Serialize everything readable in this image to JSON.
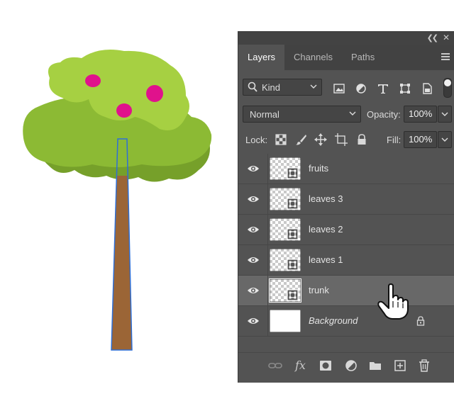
{
  "tabs": [
    {
      "label": "Layers",
      "active": true
    },
    {
      "label": "Channels",
      "active": false
    },
    {
      "label": "Paths",
      "active": false
    }
  ],
  "filter": {
    "kind_label": "Kind",
    "icons": [
      "image-filter-icon",
      "adjustment-filter-icon",
      "type-filter-icon",
      "shape-filter-icon",
      "smart-object-filter-icon"
    ]
  },
  "blend": {
    "mode": "Normal",
    "opacity_label": "Opacity:",
    "opacity_value": "100%"
  },
  "lock": {
    "label": "Lock:",
    "icons": [
      "lock-transparent-pixels-icon",
      "lock-image-pixels-icon",
      "lock-position-icon",
      "lock-artboard-icon",
      "lock-all-icon"
    ],
    "fill_label": "Fill:",
    "fill_value": "100%"
  },
  "layers": [
    {
      "name": "fruits",
      "selected": false,
      "italic": false,
      "locked": false
    },
    {
      "name": "leaves 3",
      "selected": false,
      "italic": false,
      "locked": false
    },
    {
      "name": "leaves 2",
      "selected": false,
      "italic": false,
      "locked": false
    },
    {
      "name": "leaves 1",
      "selected": false,
      "italic": false,
      "locked": false
    },
    {
      "name": "trunk",
      "selected": true,
      "italic": false,
      "locked": false
    },
    {
      "name": "Background",
      "selected": false,
      "italic": true,
      "locked": true
    }
  ],
  "bottom_icons": [
    "link-layers-icon",
    "fx-icon",
    "layer-mask-icon",
    "adjustment-layer-icon",
    "group-folder-icon",
    "new-layer-icon",
    "trash-icon"
  ],
  "colors": {
    "panel_bg": "#535353",
    "selected_row": "#686868",
    "leaves_light": "#a6d042",
    "leaves_mid": "#8cba34",
    "leaves_dark": "#76a02a",
    "fruit": "#e0128c",
    "trunk": "#9b6536",
    "selection_outline": "#2e6fd6"
  }
}
